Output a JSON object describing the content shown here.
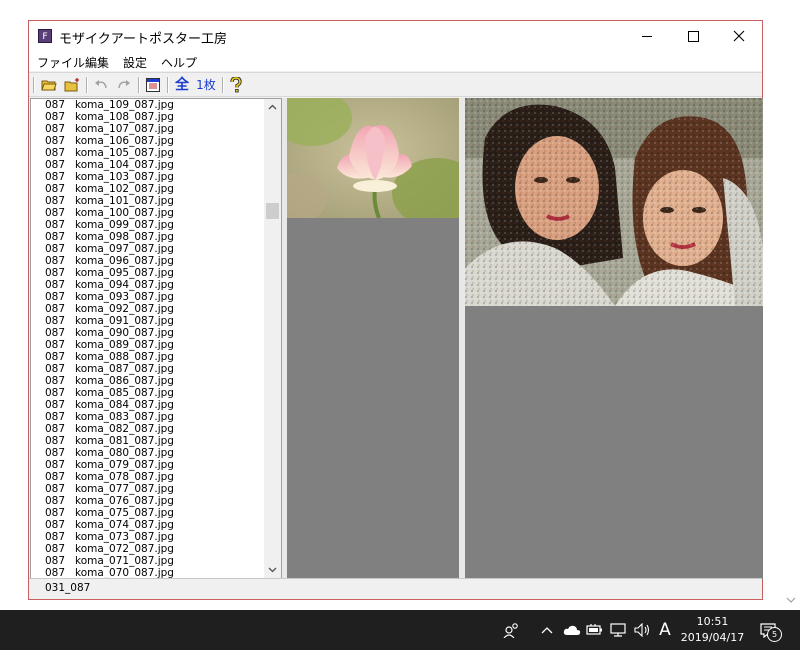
{
  "window": {
    "title": "モザイクアートポスター工房",
    "app_icon_letter": "F"
  },
  "menu": [
    "ファイル",
    "編集",
    "設定",
    "ヘルプ"
  ],
  "toolbar": {
    "all_label": "全",
    "one_sheet_label": "1枚"
  },
  "file_list": {
    "code": "087",
    "files": [
      "koma_109_087.jpg",
      "koma_108_087.jpg",
      "koma_107_087.jpg",
      "koma_106_087.jpg",
      "koma_105_087.jpg",
      "koma_104_087.jpg",
      "koma_103_087.jpg",
      "koma_102_087.jpg",
      "koma_101_087.jpg",
      "koma_100_087.jpg",
      "koma_099_087.jpg",
      "koma_098_087.jpg",
      "koma_097_087.jpg",
      "koma_096_087.jpg",
      "koma_095_087.jpg",
      "koma_094_087.jpg",
      "koma_093_087.jpg",
      "koma_092_087.jpg",
      "koma_091_087.jpg",
      "koma_090_087.jpg",
      "koma_089_087.jpg",
      "koma_088_087.jpg",
      "koma_087_087.jpg",
      "koma_086_087.jpg",
      "koma_085_087.jpg",
      "koma_084_087.jpg",
      "koma_083_087.jpg",
      "koma_082_087.jpg",
      "koma_081_087.jpg",
      "koma_080_087.jpg",
      "koma_079_087.jpg",
      "koma_078_087.jpg",
      "koma_077_087.jpg",
      "koma_076_087.jpg",
      "koma_075_087.jpg",
      "koma_074_087.jpg",
      "koma_073_087.jpg",
      "koma_072_087.jpg",
      "koma_071_087.jpg",
      "koma_070_087.jpg"
    ]
  },
  "status": {
    "text": "031_087"
  },
  "taskbar": {
    "ime_label": "A",
    "time": "10:51",
    "date": "2019/04/17",
    "notification_count": "5"
  },
  "colors": {
    "panel_gray": "#808080",
    "toolbar_blue": "#1c3ccf",
    "taskbar": "#1f1f1f",
    "window_border": "#c86060"
  }
}
